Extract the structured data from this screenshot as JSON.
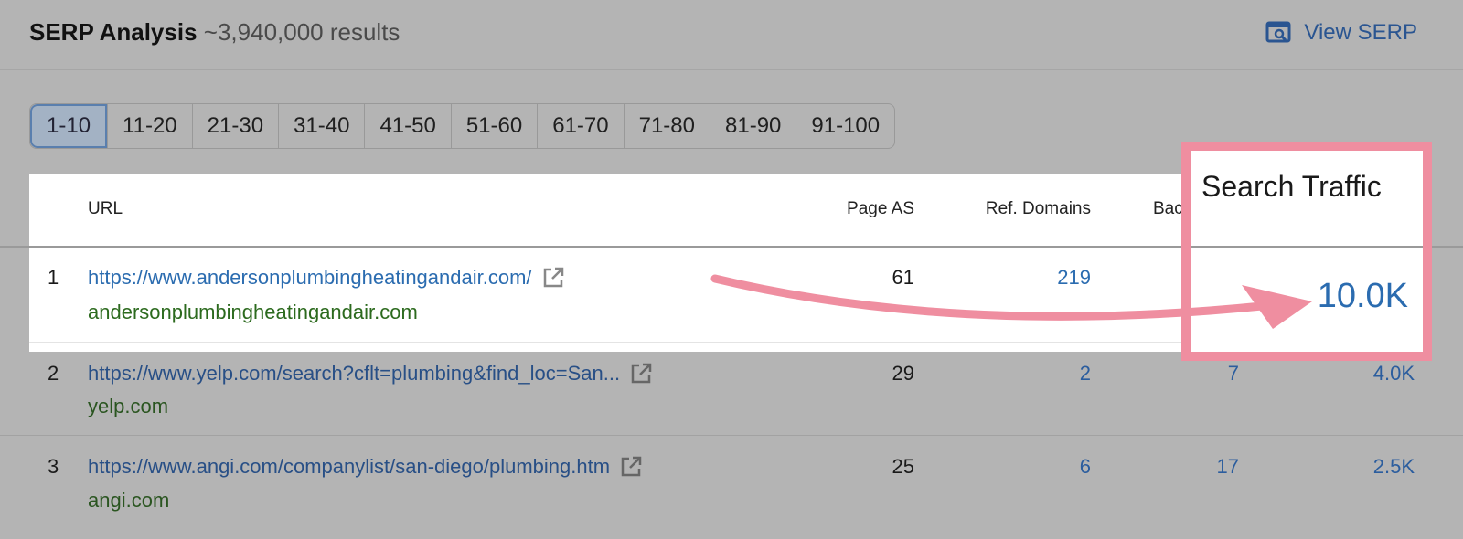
{
  "header": {
    "title": "SERP Analysis",
    "results": "~3,940,000 results",
    "view_serp": "View SERP",
    "view_serp_icon": "search-window-icon"
  },
  "pagination": [
    "1-10",
    "11-20",
    "21-30",
    "31-40",
    "41-50",
    "51-60",
    "61-70",
    "71-80",
    "81-90",
    "91-100"
  ],
  "pagination_selected": "1-10",
  "columns": {
    "url": "URL",
    "page_as": "Page AS",
    "ref_domains": "Ref. Domains",
    "backlinks": "Bac",
    "search_traffic": "Search Traffic"
  },
  "rows": [
    {
      "rank": "1",
      "url": "https://www.andersonplumbingheatingandair.com/",
      "domain": "andersonplumbingheatingandair.com",
      "page_as": "61",
      "ref_domains": "219",
      "backlinks": "",
      "traffic": "10.0K"
    },
    {
      "rank": "2",
      "url": "https://www.yelp.com/search?cflt=plumbing&find_loc=San...",
      "domain": "yelp.com",
      "page_as": "29",
      "ref_domains": "2",
      "backlinks": "7",
      "traffic": "4.0K"
    },
    {
      "rank": "3",
      "url": "https://www.angi.com/companylist/san-diego/plumbing.htm",
      "domain": "angi.com",
      "page_as": "25",
      "ref_domains": "6",
      "backlinks": "17",
      "traffic": "2.5K"
    }
  ],
  "colors": {
    "highlight": "#ef8ea0",
    "link": "#2b6cb0",
    "domain": "#2c6220",
    "overlay": "#b4b4b4"
  }
}
